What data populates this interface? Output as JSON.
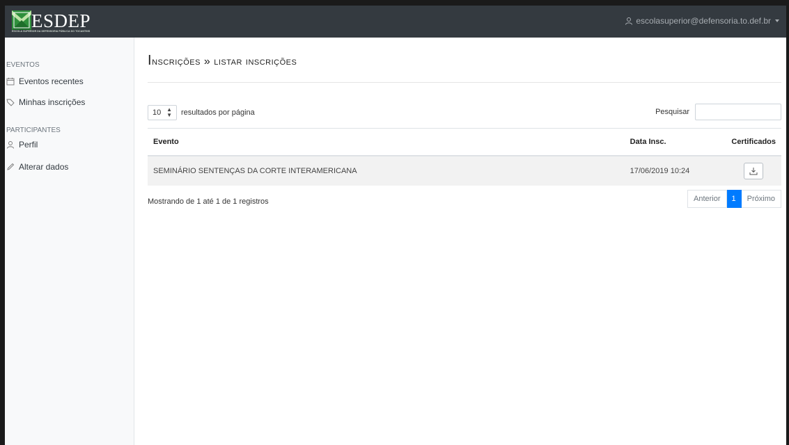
{
  "brand": {
    "name": "ESDEP",
    "subtitle": "ESCOLA SUPERIOR DA DEFENSORIA PÚBLICA DO TOCANTINS"
  },
  "user": {
    "email": "escolasuperior@defensoria.to.def.br"
  },
  "sidebar": {
    "sections": [
      {
        "heading": "EVENTOS",
        "items": [
          {
            "label": "Eventos recentes",
            "icon": "calendar-icon"
          },
          {
            "label": "Minhas inscrições",
            "icon": "tag-icon"
          }
        ]
      },
      {
        "heading": "PARTICIPANTES",
        "items": [
          {
            "label": "Perfil",
            "icon": "user-icon"
          },
          {
            "label": "Alterar dados",
            "icon": "pencil-icon"
          }
        ]
      }
    ]
  },
  "page": {
    "title_first": "I",
    "title_rest": "nscrições » listar inscrições"
  },
  "table_controls": {
    "page_size": "10",
    "page_size_label": "resultados por página",
    "search_label": "Pesquisar",
    "search_value": ""
  },
  "table": {
    "columns": [
      "Evento",
      "Data Insc.",
      "Certificados"
    ],
    "rows": [
      {
        "evento": "SEMINÁRIO SENTENÇAS DA CORTE INTERAMERICANA",
        "data": "17/06/2019 10:24",
        "cert_icon": "download-icon"
      }
    ]
  },
  "footer": {
    "info": "Mostrando de 1 até 1 de 1 registros",
    "prev": "Anterior",
    "current_page": "1",
    "next": "Próximo"
  },
  "colors": {
    "navbar": "#343a40",
    "accent": "#007bff",
    "logo_green": "#3aa34a"
  }
}
